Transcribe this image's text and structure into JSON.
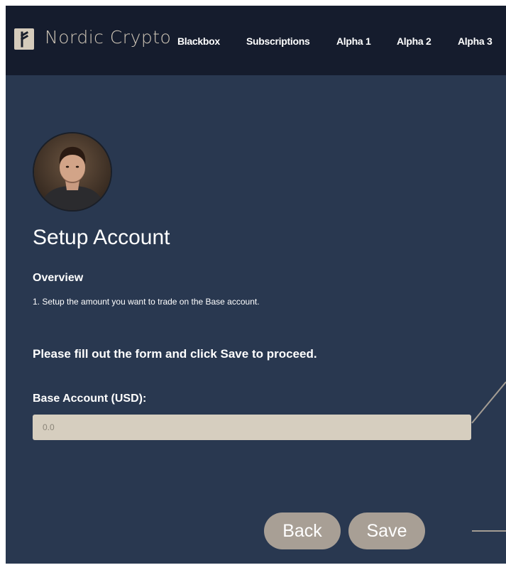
{
  "navbar": {
    "brand": "Nordic Crypto",
    "links": [
      {
        "label": "Blackbox"
      },
      {
        "label": "Subscriptions"
      },
      {
        "label": "Alpha 1"
      },
      {
        "label": "Alpha 2"
      },
      {
        "label": "Alpha 3"
      }
    ]
  },
  "page": {
    "title": "Setup Account",
    "overview_title": "Overview",
    "overview_step": "1. Setup the amount you want to trade on the Base account.",
    "instruction": "Please fill out the form and click Save to proceed."
  },
  "form": {
    "base_account_label": "Base Account (USD):",
    "base_account_value": "",
    "base_account_placeholder": "0.0"
  },
  "buttons": {
    "back_label": "Back",
    "save_label": "Save"
  },
  "colors": {
    "navbar_bg": "#151c2d",
    "page_bg": "#293850",
    "accent_beige": "#d6cebf",
    "button_bg": "#a89f95"
  },
  "icons": {
    "logo": "rune-logo-icon"
  }
}
